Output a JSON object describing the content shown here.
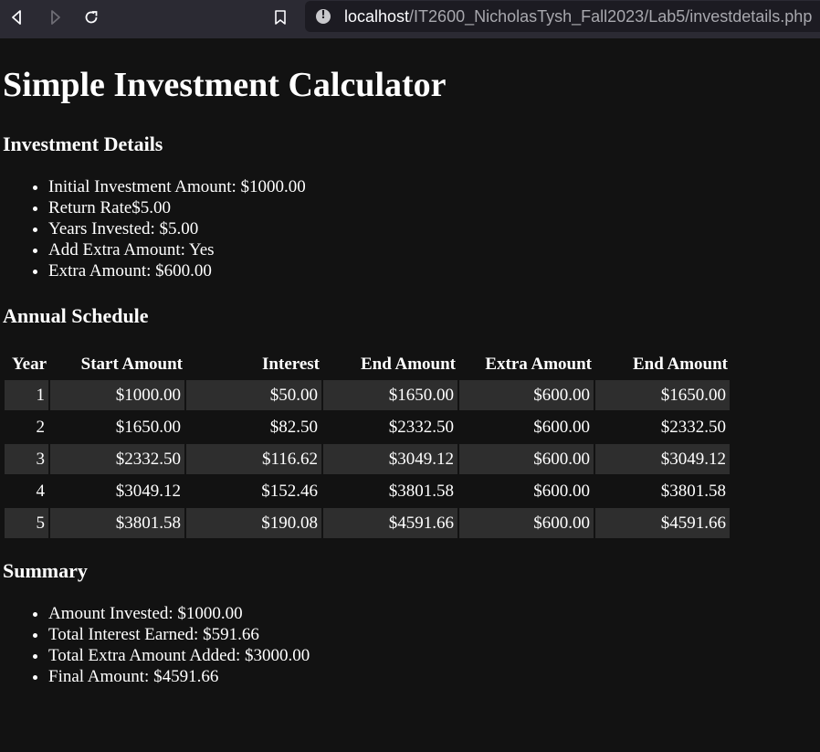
{
  "browser": {
    "url_host": "localhost",
    "url_path": "/IT2600_NicholasTysh_Fall2023/Lab5/investdetails.php",
    "icons": [
      "back-icon",
      "forward-icon",
      "reload-icon",
      "bookmark-icon",
      "info-icon"
    ]
  },
  "page": {
    "title": "Simple Investment Calculator",
    "details_heading": "Investment Details",
    "details": [
      "Initial Investment Amount: $1000.00",
      "Return Rate$5.00",
      "Years Invested: $5.00",
      "Add Extra Amount: Yes",
      "Extra Amount: $600.00"
    ],
    "schedule_heading": "Annual Schedule",
    "schedule": {
      "headers": [
        "Year",
        "Start Amount",
        "Interest",
        "End Amount",
        "Extra Amount",
        "End Amount"
      ],
      "rows": [
        [
          "1",
          "$1000.00",
          "$50.00",
          "$1650.00",
          "$600.00",
          "$1650.00"
        ],
        [
          "2",
          "$1650.00",
          "$82.50",
          "$2332.50",
          "$600.00",
          "$2332.50"
        ],
        [
          "3",
          "$2332.50",
          "$116.62",
          "$3049.12",
          "$600.00",
          "$3049.12"
        ],
        [
          "4",
          "$3049.12",
          "$152.46",
          "$3801.58",
          "$600.00",
          "$3801.58"
        ],
        [
          "5",
          "$3801.58",
          "$190.08",
          "$4591.66",
          "$600.00",
          "$4591.66"
        ]
      ]
    },
    "summary_heading": "Summary",
    "summary": [
      "Amount Invested: $1000.00",
      "Total Interest Earned: $591.66",
      "Total Extra Amount Added: $3000.00",
      "Final Amount: $4591.66"
    ]
  },
  "colors": {
    "page_background": "#121212",
    "toolbar_background": "#2b2a33",
    "urlbar_background": "#1c1b22",
    "stripe_row": "#2e2e2e",
    "text": "#ffffff"
  }
}
